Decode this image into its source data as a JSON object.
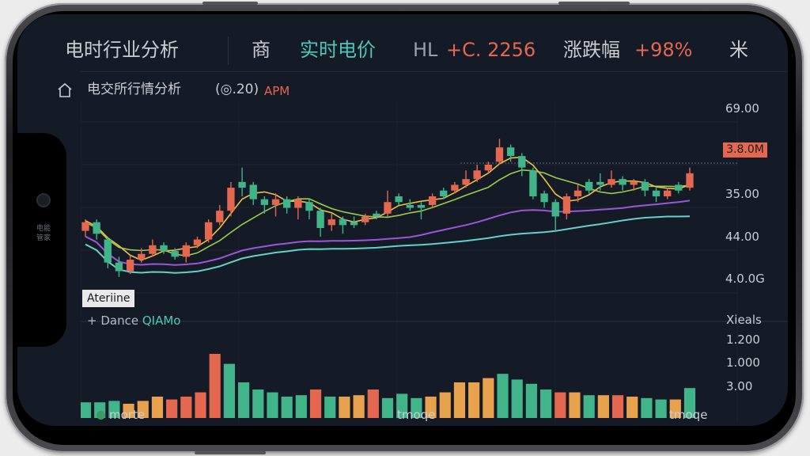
{
  "header": {
    "title": "电时行业分析",
    "filter_label": "商",
    "realtime_label": "实时电价",
    "price_prefix": "HL",
    "price_value": "+C. 2256",
    "change_label": "涨跌幅",
    "change_value": "+98%",
    "menu_glyph": "米"
  },
  "subheader": {
    "title": "电交所行情分析",
    "extra": "(◎.20)",
    "time": "APM"
  },
  "side_text": "电能管家",
  "price_axis": [
    "69.00",
    "3.8.0M",
    "35.00",
    "44.00",
    "4.0.0G"
  ],
  "price_tag": "3.8.0M",
  "legend_label": "Ateriine",
  "volume": {
    "title_prefix": "+ Dance",
    "title_suffix": "QIAMo",
    "axis_title": "Xieals",
    "axis": [
      "1.200",
      "1.000",
      "3.00"
    ]
  },
  "x_labels": [
    "morte",
    "tmoqe",
    "tmoqe"
  ],
  "colors": {
    "bg": "#151a27",
    "up": "#e3684f",
    "down": "#41b489",
    "orange": "#e8a24e",
    "ma_yellow": "#e7c24a",
    "ma_green": "#9ccc4c",
    "ma_purple": "#9a57d9",
    "ma_cyan": "#67d0c7"
  },
  "chart_data": {
    "type": "candlestick",
    "price_range": [
      0,
      100
    ],
    "candles": [
      {
        "o": 52,
        "c": 58,
        "h": 60,
        "l": 48,
        "col": "up"
      },
      {
        "o": 58,
        "c": 50,
        "h": 60,
        "l": 46,
        "col": "down"
      },
      {
        "o": 46,
        "c": 30,
        "h": 48,
        "l": 26,
        "col": "down"
      },
      {
        "o": 30,
        "c": 24,
        "h": 34,
        "l": 20,
        "col": "down"
      },
      {
        "o": 24,
        "c": 32,
        "h": 35,
        "l": 22,
        "col": "up"
      },
      {
        "o": 32,
        "c": 36,
        "h": 40,
        "l": 30,
        "col": "up"
      },
      {
        "o": 36,
        "c": 42,
        "h": 46,
        "l": 34,
        "col": "up"
      },
      {
        "o": 42,
        "c": 38,
        "h": 44,
        "l": 36,
        "col": "down"
      },
      {
        "o": 38,
        "c": 34,
        "h": 40,
        "l": 32,
        "col": "down"
      },
      {
        "o": 34,
        "c": 42,
        "h": 44,
        "l": 30,
        "col": "up"
      },
      {
        "o": 42,
        "c": 46,
        "h": 48,
        "l": 40,
        "col": "up"
      },
      {
        "o": 46,
        "c": 58,
        "h": 60,
        "l": 44,
        "col": "up"
      },
      {
        "o": 58,
        "c": 66,
        "h": 70,
        "l": 56,
        "col": "up"
      },
      {
        "o": 66,
        "c": 82,
        "h": 86,
        "l": 62,
        "col": "up"
      },
      {
        "o": 82,
        "c": 86,
        "h": 96,
        "l": 76,
        "col": "down"
      },
      {
        "o": 84,
        "c": 74,
        "h": 86,
        "l": 70,
        "col": "down"
      },
      {
        "o": 74,
        "c": 70,
        "h": 76,
        "l": 64,
        "col": "down"
      },
      {
        "o": 70,
        "c": 74,
        "h": 78,
        "l": 62,
        "col": "up"
      },
      {
        "o": 74,
        "c": 68,
        "h": 76,
        "l": 64,
        "col": "down"
      },
      {
        "o": 68,
        "c": 74,
        "h": 76,
        "l": 60,
        "col": "up"
      },
      {
        "o": 72,
        "c": 66,
        "h": 74,
        "l": 60,
        "col": "down"
      },
      {
        "o": 66,
        "c": 54,
        "h": 68,
        "l": 48,
        "col": "down"
      },
      {
        "o": 56,
        "c": 60,
        "h": 64,
        "l": 52,
        "col": "up"
      },
      {
        "o": 60,
        "c": 56,
        "h": 62,
        "l": 50,
        "col": "down"
      },
      {
        "o": 56,
        "c": 58,
        "h": 62,
        "l": 54,
        "col": "down"
      },
      {
        "o": 58,
        "c": 62,
        "h": 64,
        "l": 56,
        "col": "up"
      },
      {
        "o": 62,
        "c": 64,
        "h": 66,
        "l": 60,
        "col": "down"
      },
      {
        "o": 64,
        "c": 72,
        "h": 80,
        "l": 62,
        "col": "up"
      },
      {
        "o": 72,
        "c": 76,
        "h": 78,
        "l": 70,
        "col": "down"
      },
      {
        "o": 70,
        "c": 68,
        "h": 74,
        "l": 66,
        "col": "down"
      },
      {
        "o": 68,
        "c": 70,
        "h": 72,
        "l": 60,
        "col": "down"
      },
      {
        "o": 70,
        "c": 76,
        "h": 78,
        "l": 68,
        "col": "up"
      },
      {
        "o": 76,
        "c": 80,
        "h": 82,
        "l": 74,
        "col": "down"
      },
      {
        "o": 80,
        "c": 84,
        "h": 86,
        "l": 78,
        "col": "up"
      },
      {
        "o": 84,
        "c": 88,
        "h": 94,
        "l": 82,
        "col": "up"
      },
      {
        "o": 88,
        "c": 94,
        "h": 98,
        "l": 86,
        "col": "up"
      },
      {
        "o": 94,
        "c": 98,
        "h": 100,
        "l": 92,
        "col": "up"
      },
      {
        "o": 100,
        "c": 110,
        "h": 116,
        "l": 98,
        "col": "up"
      },
      {
        "o": 110,
        "c": 104,
        "h": 112,
        "l": 100,
        "col": "down"
      },
      {
        "o": 104,
        "c": 96,
        "h": 106,
        "l": 90,
        "col": "down"
      },
      {
        "o": 94,
        "c": 76,
        "h": 96,
        "l": 74,
        "col": "down"
      },
      {
        "o": 78,
        "c": 72,
        "h": 80,
        "l": 68,
        "col": "down"
      },
      {
        "o": 72,
        "c": 62,
        "h": 74,
        "l": 52,
        "col": "down"
      },
      {
        "o": 64,
        "c": 76,
        "h": 78,
        "l": 60,
        "col": "up"
      },
      {
        "o": 76,
        "c": 80,
        "h": 84,
        "l": 72,
        "col": "up"
      },
      {
        "o": 80,
        "c": 86,
        "h": 88,
        "l": 78,
        "col": "down"
      },
      {
        "o": 86,
        "c": 84,
        "h": 92,
        "l": 80,
        "col": "down"
      },
      {
        "o": 84,
        "c": 88,
        "h": 94,
        "l": 82,
        "col": "up"
      },
      {
        "o": 88,
        "c": 84,
        "h": 90,
        "l": 80,
        "col": "down"
      },
      {
        "o": 84,
        "c": 86,
        "h": 88,
        "l": 80,
        "col": "up"
      },
      {
        "o": 86,
        "c": 80,
        "h": 88,
        "l": 76,
        "col": "down"
      },
      {
        "o": 80,
        "c": 76,
        "h": 82,
        "l": 72,
        "col": "down"
      },
      {
        "o": 76,
        "c": 80,
        "h": 82,
        "l": 74,
        "col": "up"
      },
      {
        "o": 80,
        "c": 84,
        "h": 86,
        "l": 78,
        "col": "down"
      },
      {
        "o": 82,
        "c": 92,
        "h": 96,
        "l": 80,
        "col": "up"
      }
    ],
    "volume": [
      {
        "v": 22,
        "col": "down"
      },
      {
        "v": 22,
        "col": "down"
      },
      {
        "v": 24,
        "col": "down"
      },
      {
        "v": 20,
        "col": "orange"
      },
      {
        "v": 24,
        "col": "orange"
      },
      {
        "v": 30,
        "col": "orange"
      },
      {
        "v": 26,
        "col": "up"
      },
      {
        "v": 30,
        "col": "up"
      },
      {
        "v": 36,
        "col": "up"
      },
      {
        "v": 90,
        "col": "up"
      },
      {
        "v": 76,
        "col": "down"
      },
      {
        "v": 50,
        "col": "down"
      },
      {
        "v": 40,
        "col": "down"
      },
      {
        "v": 36,
        "col": "down"
      },
      {
        "v": 30,
        "col": "down"
      },
      {
        "v": 32,
        "col": "down"
      },
      {
        "v": 40,
        "col": "up"
      },
      {
        "v": 30,
        "col": "down"
      },
      {
        "v": 30,
        "col": "orange"
      },
      {
        "v": 32,
        "col": "orange"
      },
      {
        "v": 40,
        "col": "up"
      },
      {
        "v": 28,
        "col": "down"
      },
      {
        "v": 34,
        "col": "down"
      },
      {
        "v": 28,
        "col": "down"
      },
      {
        "v": 30,
        "col": "orange"
      },
      {
        "v": 36,
        "col": "orange"
      },
      {
        "v": 50,
        "col": "orange"
      },
      {
        "v": 50,
        "col": "orange"
      },
      {
        "v": 56,
        "col": "orange"
      },
      {
        "v": 62,
        "col": "down"
      },
      {
        "v": 54,
        "col": "down"
      },
      {
        "v": 48,
        "col": "down"
      },
      {
        "v": 40,
        "col": "down"
      },
      {
        "v": 36,
        "col": "up"
      },
      {
        "v": 36,
        "col": "orange"
      },
      {
        "v": 32,
        "col": "down"
      },
      {
        "v": 32,
        "col": "orange"
      },
      {
        "v": 32,
        "col": "up"
      },
      {
        "v": 30,
        "col": "orange"
      },
      {
        "v": 28,
        "col": "down"
      },
      {
        "v": 26,
        "col": "down"
      },
      {
        "v": 26,
        "col": "orange"
      },
      {
        "v": 42,
        "col": "down"
      }
    ]
  }
}
